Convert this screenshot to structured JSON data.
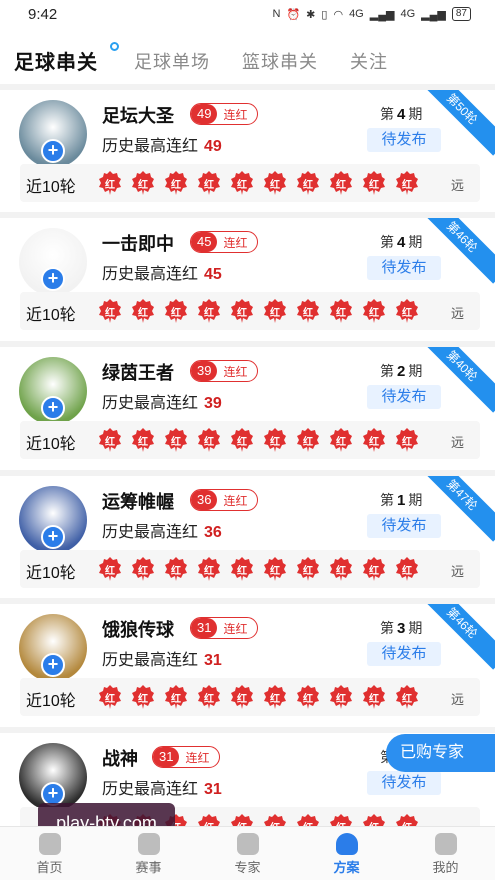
{
  "status_bar": {
    "time": "9:42",
    "battery": "87",
    "net1": "4G",
    "net2": "4G"
  },
  "tabs": [
    {
      "label": "足球串关",
      "active": true
    },
    {
      "label": "足球单场",
      "active": false
    },
    {
      "label": "篮球串关",
      "active": false
    },
    {
      "label": "关注",
      "active": false
    }
  ],
  "cards": [
    {
      "name": "足坛大圣",
      "streak": "49",
      "streak_label": "连红",
      "best_label": "历史最高连红",
      "best": "49",
      "period_prefix": "第",
      "period": "4",
      "period_suffix": "期",
      "status": "待发布",
      "ribbon": "第50轮",
      "recent_label": "近10轮",
      "far_label": "远",
      "results": [
        "红",
        "红",
        "红",
        "红",
        "红",
        "红",
        "红",
        "红",
        "红",
        "红"
      ],
      "avatar_color": "#6a8a9c"
    },
    {
      "name": "一击即中",
      "streak": "45",
      "streak_label": "连红",
      "best_label": "历史最高连红",
      "best": "45",
      "period_prefix": "第",
      "period": "4",
      "period_suffix": "期",
      "status": "待发布",
      "ribbon": "第46轮",
      "recent_label": "近10轮",
      "far_label": "远",
      "results": [
        "红",
        "红",
        "红",
        "红",
        "红",
        "红",
        "红",
        "红",
        "红",
        "红"
      ],
      "avatar_color": "#f2f2f2"
    },
    {
      "name": "绿茵王者",
      "streak": "39",
      "streak_label": "连红",
      "best_label": "历史最高连红",
      "best": "39",
      "period_prefix": "第",
      "period": "2",
      "period_suffix": "期",
      "status": "待发布",
      "ribbon": "第40轮",
      "recent_label": "近10轮",
      "far_label": "远",
      "results": [
        "红",
        "红",
        "红",
        "红",
        "红",
        "红",
        "红",
        "红",
        "红",
        "红"
      ],
      "avatar_color": "#6fa24a"
    },
    {
      "name": "运筹帷幄",
      "streak": "36",
      "streak_label": "连红",
      "best_label": "历史最高连红",
      "best": "36",
      "period_prefix": "第",
      "period": "1",
      "period_suffix": "期",
      "status": "待发布",
      "ribbon": "第47轮",
      "recent_label": "近10轮",
      "far_label": "远",
      "results": [
        "红",
        "红",
        "红",
        "红",
        "红",
        "红",
        "红",
        "红",
        "红",
        "红"
      ],
      "avatar_color": "#3f5fa6"
    },
    {
      "name": "饿狼传球",
      "streak": "31",
      "streak_label": "连红",
      "best_label": "历史最高连红",
      "best": "31",
      "period_prefix": "第",
      "period": "3",
      "period_suffix": "期",
      "status": "待发布",
      "ribbon": "第46轮",
      "recent_label": "近10轮",
      "far_label": "远",
      "results": [
        "红",
        "红",
        "红",
        "红",
        "红",
        "红",
        "红",
        "红",
        "红",
        "红"
      ],
      "avatar_color": "#b3883c"
    },
    {
      "name": "战神",
      "streak": "31",
      "streak_label": "连红",
      "best_label": "历史最高连红",
      "best": "31",
      "period_prefix": "第",
      "period": "",
      "period_suffix": "",
      "status": "待发布",
      "ribbon": "",
      "recent_label": "",
      "far_label": "",
      "results": [
        "红",
        "红",
        "红",
        "红",
        "红",
        "红",
        "红",
        "红",
        "红",
        "红"
      ],
      "avatar_color": "#2c2c2c"
    }
  ],
  "floating_button": "已购专家",
  "watermark": "play-bty.com",
  "nav": [
    {
      "label": "首页",
      "icon": "home-icon",
      "active": false
    },
    {
      "label": "赛事",
      "icon": "trophy-icon",
      "active": false
    },
    {
      "label": "专家",
      "icon": "expert-icon",
      "active": false
    },
    {
      "label": "方案",
      "icon": "plan-icon",
      "active": true
    },
    {
      "label": "我的",
      "icon": "profile-icon",
      "active": false
    }
  ],
  "colors": {
    "accent": "#2b7de9",
    "red": "#e03030",
    "ribbon": "#2390ee"
  }
}
